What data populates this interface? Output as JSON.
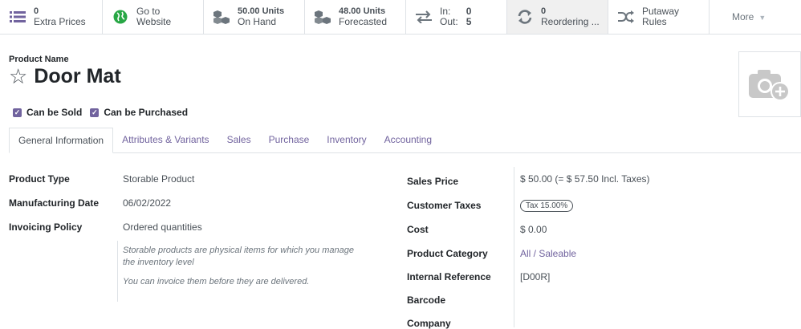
{
  "stat_buttons": {
    "extra_prices": {
      "value": "0",
      "label": "Extra Prices"
    },
    "website": {
      "line1": "Go to",
      "line2": "Website"
    },
    "on_hand": {
      "value": "50.00 Units",
      "label": "On Hand"
    },
    "forecasted": {
      "value": "48.00 Units",
      "label": "Forecasted"
    },
    "in_out": {
      "in_label": "In:",
      "in_value": "0",
      "out_label": "Out:",
      "out_value": "5"
    },
    "reordering": {
      "value": "0",
      "label": "Reordering ..."
    },
    "putaway": {
      "label": "Putaway Rules"
    },
    "more": {
      "label": "More"
    }
  },
  "product": {
    "name_label": "Product Name",
    "name": "Door Mat",
    "can_be_sold": "Can be Sold",
    "can_be_purchased": "Can be Purchased"
  },
  "tabs": [
    "General Information",
    "Attributes & Variants",
    "Sales",
    "Purchase",
    "Inventory",
    "Accounting"
  ],
  "left_fields": {
    "product_type": {
      "label": "Product Type",
      "value": "Storable Product"
    },
    "manufacturing_date": {
      "label": "Manufacturing Date",
      "value": "06/02/2022"
    },
    "invoicing_policy": {
      "label": "Invoicing Policy",
      "value": "Ordered quantities"
    },
    "help1_line1": "Storable products are physical items for which you manage",
    "help1_line2": "the inventory level",
    "help2": "You can invoice them before they are delivered."
  },
  "right_fields": {
    "sales_price": {
      "label": "Sales Price",
      "value": "$ 50.00  (= $ 57.50 Incl. Taxes)"
    },
    "customer_taxes": {
      "label": "Customer Taxes",
      "value": "Tax 15.00%"
    },
    "cost": {
      "label": "Cost",
      "value": "$ 0.00"
    },
    "product_category": {
      "label": "Product Category",
      "value": "All / Saleable"
    },
    "internal_reference": {
      "label": "Internal Reference",
      "value": "[D00R]"
    },
    "barcode": {
      "label": "Barcode",
      "value": ""
    },
    "company": {
      "label": "Company",
      "value": ""
    }
  },
  "colors": {
    "accent": "#71639e",
    "border": "#dee2e6",
    "website_icon": "#28a745"
  }
}
